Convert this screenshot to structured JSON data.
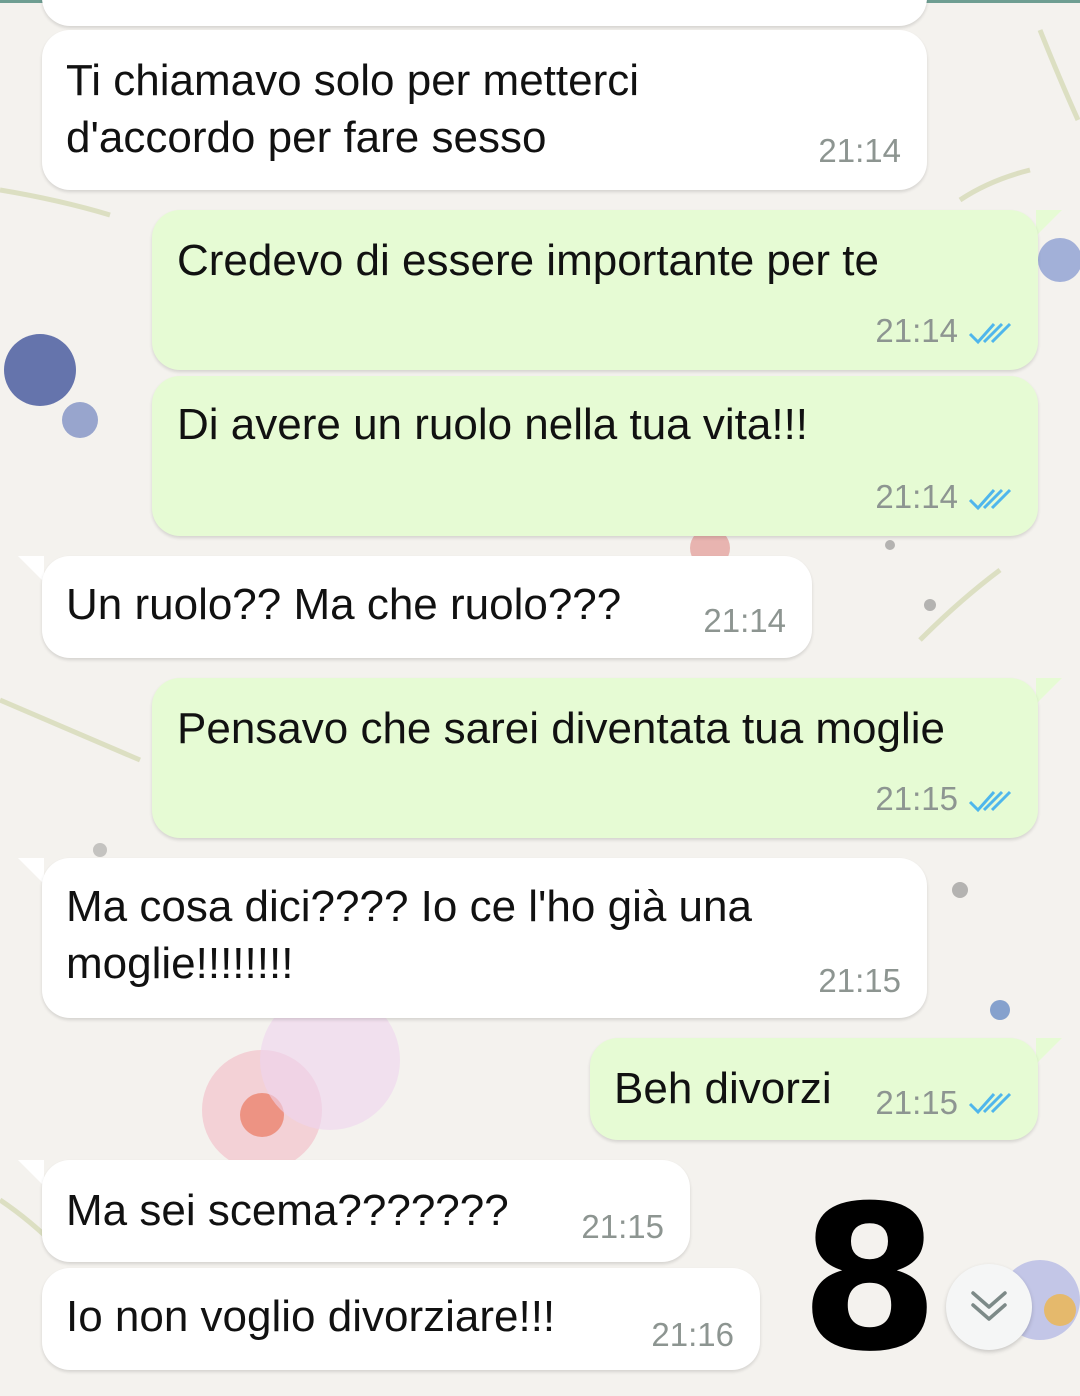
{
  "chat": {
    "messages": [
      {
        "dir": "in",
        "text": "Ti chiamavo solo per metterci\nd'accordo per fare sesso",
        "time": "21:14"
      },
      {
        "dir": "out",
        "text": "Credevo di essere importante per te",
        "time": "21:14",
        "status": "read"
      },
      {
        "dir": "out",
        "text": "Di avere un ruolo nella tua vita!!!",
        "time": "21:14",
        "status": "read"
      },
      {
        "dir": "in",
        "text": "Un ruolo?? Ma che ruolo???",
        "time": "21:14"
      },
      {
        "dir": "out",
        "text": "Pensavo che sarei diventata tua moglie",
        "time": "21:15",
        "status": "read"
      },
      {
        "dir": "in",
        "text": "Ma cosa dici???? Io ce l'ho già una\nmoglie!!!!!!!!",
        "time": "21:15"
      },
      {
        "dir": "out",
        "text": "Beh divorzi",
        "time": "21:15",
        "status": "read"
      },
      {
        "dir": "in",
        "text": "Ma sei scema???????",
        "time": "21:15"
      },
      {
        "dir": "in",
        "text": "Io non voglio divorziare!!!",
        "time": "21:16"
      }
    ]
  },
  "overlay": {
    "number": "8"
  },
  "icons": {
    "read_receipt": "double-check-icon",
    "scroll_down": "chevron-double-down-icon"
  },
  "colors": {
    "incoming_bubble": "#ffffff",
    "outgoing_bubble": "#e6fbd4",
    "read_tick": "#4fb6ec",
    "timestamp": "#8d9591"
  }
}
